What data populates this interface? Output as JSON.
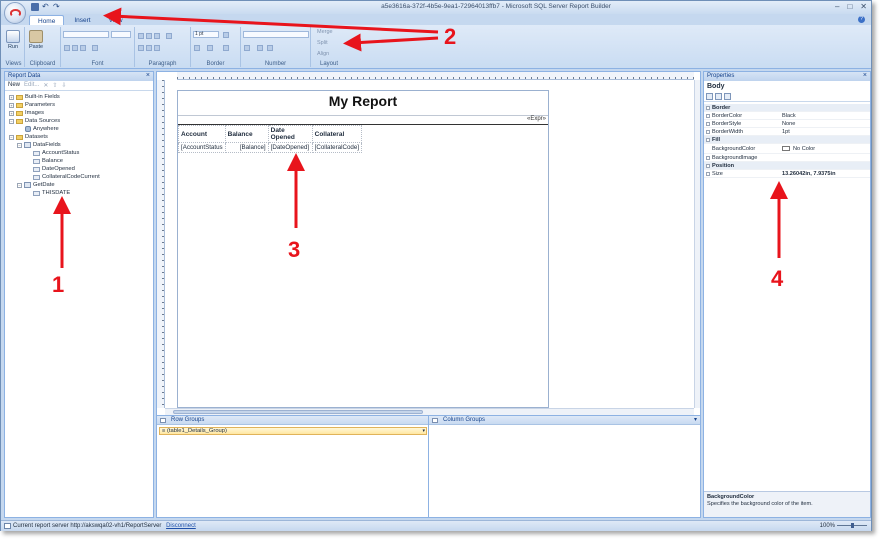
{
  "window": {
    "title": "a5e3616a-372f-4b5e-9ea1-72964013ffb7 - Microsoft SQL Server Report Builder",
    "controls": [
      "–",
      "□",
      "✕"
    ]
  },
  "ribbon": {
    "tabs": [
      "Home",
      "Insert",
      "View"
    ],
    "run_label": "Run",
    "paste_label": "Paste",
    "groups": [
      "Views",
      "Clipboard",
      "Font",
      "Paragraph",
      "Border",
      "Number",
      "Layout"
    ],
    "border_width": "1 pt",
    "merge_label": "Merge",
    "split_label": "Split",
    "align_label": "Align"
  },
  "report_data": {
    "title": "Report Data",
    "new_label": "New",
    "edit_label": "Edit...",
    "tree": [
      {
        "label": "Built-in Fields",
        "icon": "folder"
      },
      {
        "label": "Parameters",
        "icon": "folder"
      },
      {
        "label": "Images",
        "icon": "folder"
      },
      {
        "label": "Data Sources",
        "icon": "folder"
      },
      {
        "label": "Anywhere",
        "icon": "database"
      },
      {
        "label": "Datasets",
        "icon": "folder"
      },
      {
        "label": "DataFields",
        "icon": "dataset"
      },
      {
        "label": "AccountStatus",
        "icon": "field"
      },
      {
        "label": "Balance",
        "icon": "field"
      },
      {
        "label": "DateOpened",
        "icon": "field"
      },
      {
        "label": "CollateralCodeCurrent",
        "icon": "field"
      },
      {
        "label": "GetDate",
        "icon": "dataset"
      },
      {
        "label": "THISDATE",
        "icon": "field"
      }
    ]
  },
  "report": {
    "title": "My Report",
    "header_expr": "«Expr»",
    "columns": [
      "Account",
      "Balance",
      "Date Opened",
      "Collateral"
    ],
    "row": [
      "[AccountStatus",
      "[Balance]",
      "[DateOpened]",
      "[CollateralCode]"
    ]
  },
  "grouping": {
    "row_groups_label": "Row Groups",
    "column_groups_label": "Column Groups",
    "row_group_item": "≡ (table1_Details_Group)"
  },
  "properties": {
    "title": "Properties",
    "object": "Body",
    "rows": [
      {
        "key": "Border",
        "value": "",
        "category": true
      },
      {
        "key": "BorderColor",
        "value": "Black",
        "category": false
      },
      {
        "key": "BorderStyle",
        "value": "None",
        "category": false
      },
      {
        "key": "BorderWidth",
        "value": "1pt",
        "category": false
      },
      {
        "key": "Fill",
        "value": "",
        "category": true
      },
      {
        "key": "BackgroundColor",
        "value": "No Color",
        "category": false
      },
      {
        "key": "BackgroundImage",
        "value": "",
        "category": false
      },
      {
        "key": "Position",
        "value": "",
        "category": true
      },
      {
        "key": "Size",
        "value": "13.26042in, 7.9375in",
        "category": false
      }
    ],
    "desc_title": "BackgroundColor",
    "desc_text": "Specifies the background color of the item."
  },
  "statusbar": {
    "text": "Current report server http://akswqa02-vh1/ReportServer",
    "disconnect": "Disconnect",
    "zoom": "100%"
  },
  "annotations": [
    "1",
    "2",
    "3",
    "4"
  ],
  "colors": {
    "annotation": "#e8141c",
    "accent": "#15428b"
  }
}
